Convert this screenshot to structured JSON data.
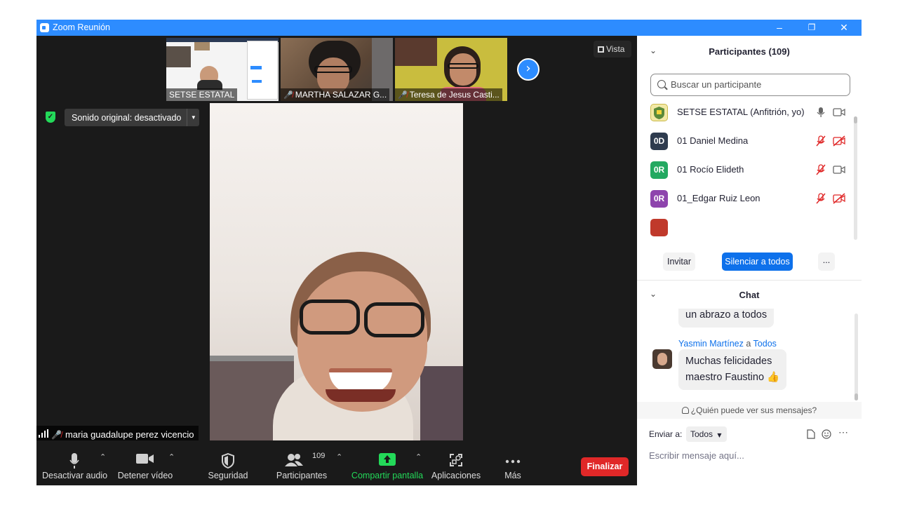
{
  "window": {
    "title": "Zoom Reunión",
    "controls": {
      "minimize": "–",
      "restore": "❐",
      "close": "✕"
    }
  },
  "video": {
    "thumbnails": [
      {
        "name": "SETSE ESTATAL",
        "muted": false
      },
      {
        "name": "MARTHA SALAZAR G...",
        "muted": true
      },
      {
        "name": "Teresa de Jesus Casti...",
        "muted": true
      }
    ],
    "view_label": "Vista",
    "original_sound": "Sonido original: desactivado",
    "active_speaker": "maria guadalupe perez vicencio"
  },
  "toolbar": {
    "audio": "Desactivar audio",
    "video": "Detener vídeo",
    "security": "Seguridad",
    "participants": "Participantes",
    "participants_count": "109",
    "share": "Compartir pantalla",
    "apps": "Aplicaciones",
    "more": "Más",
    "end": "Finalizar"
  },
  "participants_panel": {
    "title": "Participantes (109)",
    "search_placeholder": "Buscar un participante",
    "list": [
      {
        "name": "SETSE ESTATAL (Anfitrión, yo)",
        "initials": "",
        "color": "#f2e9a6",
        "mic_muted": false,
        "cam_off": false
      },
      {
        "name": "01 Daniel Medina",
        "initials": "0D",
        "color": "#2e3b4e",
        "mic_muted": true,
        "cam_off": true
      },
      {
        "name": "01 Rocío Elideth",
        "initials": "0R",
        "color": "#23a961",
        "mic_muted": true,
        "cam_off": false
      },
      {
        "name": "01_Edgar Ruiz Leon",
        "initials": "0R",
        "color": "#8e44ad",
        "mic_muted": true,
        "cam_off": true
      }
    ],
    "invite": "Invitar",
    "mute_all": "Silenciar a todos",
    "more": "..."
  },
  "chat": {
    "title": "Chat",
    "prev_message": "un abrazo a todos",
    "sender": "Yasmin Martínez",
    "connector": "a",
    "recipient": "Todos",
    "message_line1": "Muchas felicidades",
    "message_line2": "maestro Faustino 👍",
    "who_sees": "¿Quién puede ver sus mensajes?",
    "send_to_label": "Enviar a:",
    "send_to_value": "Todos",
    "compose_placeholder": "Escribir mensaje aquí..."
  },
  "colors": {
    "zoom_blue": "#2d8cff",
    "end_red": "#e02828",
    "share_green": "#23d959"
  }
}
